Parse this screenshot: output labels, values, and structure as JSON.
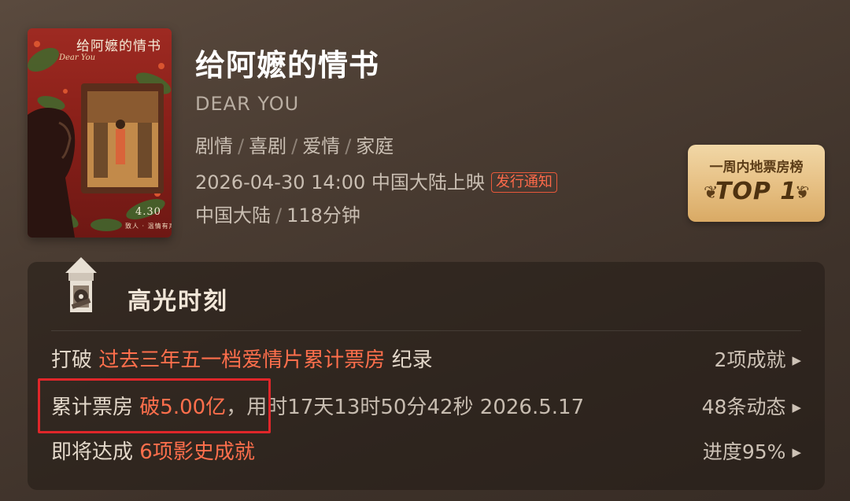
{
  "poster": {
    "title": "给阿嬷的情书",
    "english": "Dear You",
    "date": "4.30",
    "tagline": "致人 · 温情有声"
  },
  "movie": {
    "title": "给阿嬷的情书",
    "english_title": "DEAR YOU",
    "genres": [
      "剧情",
      "喜剧",
      "爱情",
      "家庭"
    ],
    "release": "2026-04-30 14:00 中国大陆上映",
    "notice_badge": "发行通知",
    "region": "中国大陆",
    "duration": "118分钟"
  },
  "top_badge": {
    "label": "一周内地票房榜",
    "rank": "TOP 1"
  },
  "highlights": {
    "title": "高光时刻",
    "rows": [
      {
        "prefix": "打破",
        "highlight": "过去三年五一档爱情片累计票房",
        "suffix": "纪录",
        "right": "2项成就"
      },
      {
        "prefix": "累计票房",
        "highlight": "破5.00亿",
        "suffix": "，用时17天13时50分42秒 2026.5.17",
        "right": "48条动态"
      },
      {
        "prefix": "即将达成",
        "highlight": "6项影史成就",
        "suffix": "",
        "right": "进度95%"
      }
    ]
  },
  "colors": {
    "highlight": "#ff6f4c",
    "badge_gold": "#e6bf82",
    "annotation_box": "#e0262a"
  },
  "icons": [
    "film-reel-icon",
    "laurel-icon",
    "chevron-right-icon"
  ]
}
